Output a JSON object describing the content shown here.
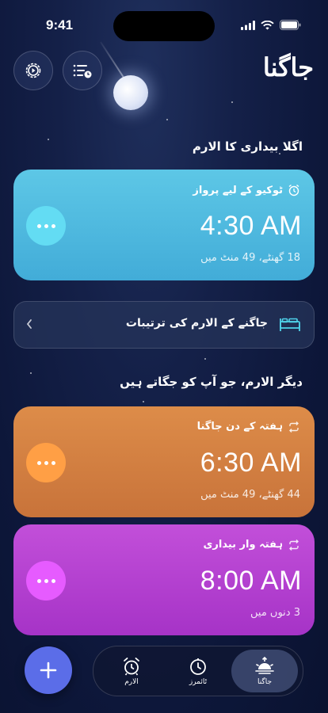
{
  "status_bar": {
    "time": "9:41"
  },
  "header": {
    "app_title": "جاگنا"
  },
  "next_alarm": {
    "section_title": "اگلا بیداری کا الارم",
    "label": "ٹوکیو کے لیے پرواز",
    "time": "4:30 AM",
    "countdown": "18 گھنٹے، 49 منٹ میں",
    "color": "#4db8df"
  },
  "wake_settings": {
    "label": "جاگنے کے الارم کی ترتیبات"
  },
  "other_alarms": {
    "section_title": "دیگر الارم، جو آپ کو جگاتے ہیں",
    "items": [
      {
        "label": "ہفتہ کے دن جاگنا",
        "time": "6:30 AM",
        "countdown": "44 گھنٹے، 49 منٹ میں",
        "color": "#d6813f"
      },
      {
        "label": "ہفتہ وار بیداری",
        "time": "8:00 AM",
        "countdown": "3 دنوں میں",
        "color": "#b73fd1"
      }
    ]
  },
  "tabbar": {
    "tabs": [
      {
        "label": "الارم",
        "icon": "alarm-clock-icon"
      },
      {
        "label": "ٹائمرز",
        "icon": "timer-icon"
      },
      {
        "label": "جاگنا",
        "icon": "sunrise-icon",
        "active": true
      }
    ]
  }
}
